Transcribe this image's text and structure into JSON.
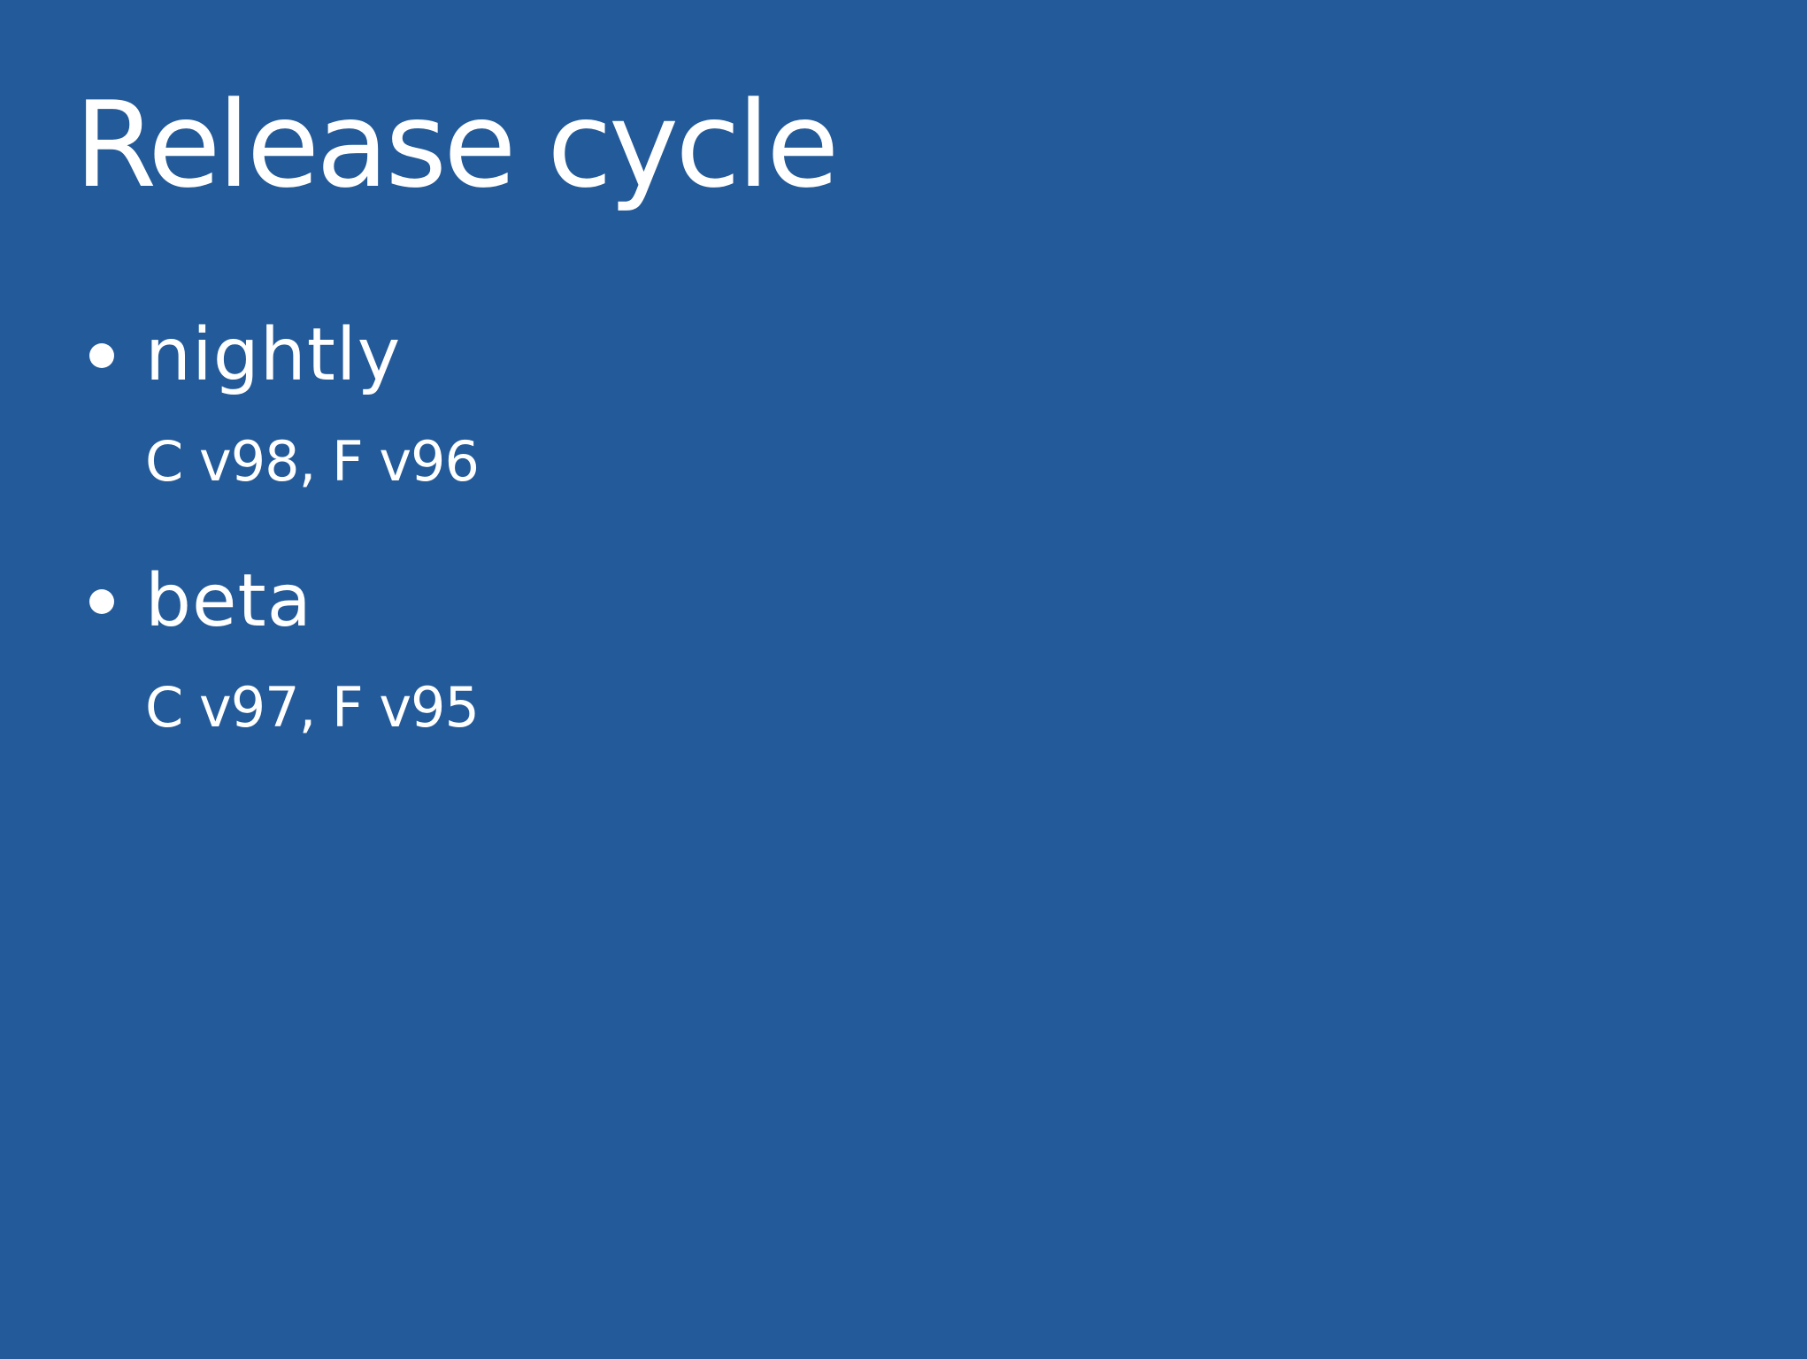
{
  "slide": {
    "title": "Release cycle",
    "items": [
      {
        "label": "nightly",
        "detail": "C v98, F v96"
      },
      {
        "label": "beta",
        "detail": "C v97, F v95"
      }
    ]
  },
  "colors": {
    "background": "#235A99",
    "text": "#FFFFFF"
  }
}
